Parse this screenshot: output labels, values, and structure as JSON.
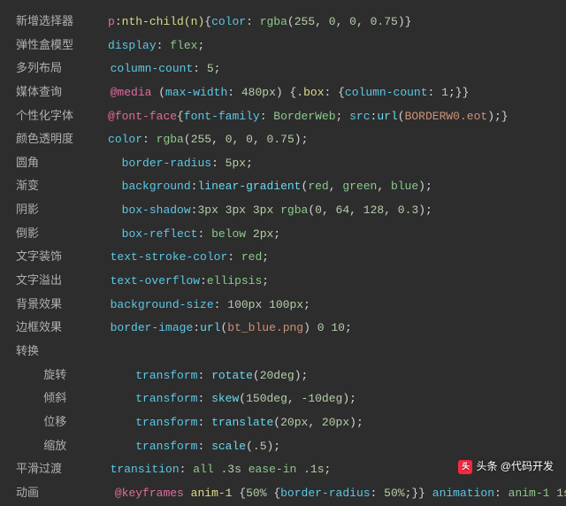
{
  "watermark": {
    "text": "头条 @代码开发"
  },
  "lines": [
    {
      "label": "新增选择器",
      "pad": "     ",
      "tokens": [
        {
          "t": "p",
          "c": "p-pink"
        },
        {
          "t": ":nth-child(n)",
          "c": "p-yellow"
        },
        {
          "t": "{",
          "c": "p-white"
        },
        {
          "t": "color",
          "c": "p-blue"
        },
        {
          "t": ": ",
          "c": "p-white"
        },
        {
          "t": "rgba",
          "c": "p-green"
        },
        {
          "t": "(",
          "c": "p-white"
        },
        {
          "t": "255",
          "c": "p-num"
        },
        {
          "t": ", ",
          "c": "p-white"
        },
        {
          "t": "0",
          "c": "p-num"
        },
        {
          "t": ", ",
          "c": "p-white"
        },
        {
          "t": "0",
          "c": "p-num"
        },
        {
          "t": ", ",
          "c": "p-white"
        },
        {
          "t": "0.75",
          "c": "p-num"
        },
        {
          "t": ")}",
          "c": "p-white"
        }
      ]
    },
    {
      "label": "弹性盒模型",
      "pad": "     ",
      "tokens": [
        {
          "t": "display",
          "c": "p-blue"
        },
        {
          "t": ": ",
          "c": "p-white"
        },
        {
          "t": "flex",
          "c": "p-green"
        },
        {
          "t": ";",
          "c": "p-white"
        }
      ]
    },
    {
      "label": "多列布局",
      "pad": "       ",
      "tokens": [
        {
          "t": "column-count",
          "c": "p-blue"
        },
        {
          "t": ": ",
          "c": "p-white"
        },
        {
          "t": "5",
          "c": "p-num"
        },
        {
          "t": ";",
          "c": "p-white"
        }
      ]
    },
    {
      "label": "媒体查询",
      "pad": "       ",
      "tokens": [
        {
          "t": "@media ",
          "c": "p-pink"
        },
        {
          "t": "(",
          "c": "p-white"
        },
        {
          "t": "max-width",
          "c": "p-blue"
        },
        {
          "t": ": ",
          "c": "p-white"
        },
        {
          "t": "480px",
          "c": "p-num"
        },
        {
          "t": ") {",
          "c": "p-white"
        },
        {
          "t": ".box",
          "c": "p-yellow"
        },
        {
          "t": ": {",
          "c": "p-white"
        },
        {
          "t": "column-count",
          "c": "p-blue"
        },
        {
          "t": ": ",
          "c": "p-white"
        },
        {
          "t": "1",
          "c": "p-num"
        },
        {
          "t": ";}}",
          "c": "p-white"
        }
      ]
    },
    {
      "label": "个性化字体",
      "pad": "     ",
      "tokens": [
        {
          "t": "@font-face",
          "c": "p-pink"
        },
        {
          "t": "{",
          "c": "p-white"
        },
        {
          "t": "font-family",
          "c": "p-blue"
        },
        {
          "t": ": ",
          "c": "p-white"
        },
        {
          "t": "BorderWeb",
          "c": "p-green"
        },
        {
          "t": "; ",
          "c": "p-white"
        },
        {
          "t": "src",
          "c": "p-blue"
        },
        {
          "t": ":",
          "c": "p-white"
        },
        {
          "t": "url",
          "c": "p-func"
        },
        {
          "t": "(",
          "c": "p-white"
        },
        {
          "t": "BORDERW0.eot",
          "c": "p-str"
        },
        {
          "t": ");}",
          "c": "p-white"
        }
      ]
    },
    {
      "label": "颜色透明度",
      "pad": "     ",
      "tokens": [
        {
          "t": "color",
          "c": "p-blue"
        },
        {
          "t": ": ",
          "c": "p-white"
        },
        {
          "t": "rgba",
          "c": "p-green"
        },
        {
          "t": "(",
          "c": "p-white"
        },
        {
          "t": "255",
          "c": "p-num"
        },
        {
          "t": ", ",
          "c": "p-white"
        },
        {
          "t": "0",
          "c": "p-num"
        },
        {
          "t": ", ",
          "c": "p-white"
        },
        {
          "t": "0",
          "c": "p-num"
        },
        {
          "t": ", ",
          "c": "p-white"
        },
        {
          "t": "0.75",
          "c": "p-num"
        },
        {
          "t": ");",
          "c": "p-white"
        }
      ]
    },
    {
      "label": "圆角",
      "pad": "            ",
      "tokens": [
        {
          "t": "border-radius",
          "c": "p-blue"
        },
        {
          "t": ": ",
          "c": "p-white"
        },
        {
          "t": "5px",
          "c": "p-num"
        },
        {
          "t": ";",
          "c": "p-white"
        }
      ]
    },
    {
      "label": "渐变",
      "pad": "            ",
      "tokens": [
        {
          "t": "background",
          "c": "p-blue"
        },
        {
          "t": ":",
          "c": "p-white"
        },
        {
          "t": "linear-gradient",
          "c": "p-func"
        },
        {
          "t": "(",
          "c": "p-white"
        },
        {
          "t": "red",
          "c": "p-green"
        },
        {
          "t": ", ",
          "c": "p-white"
        },
        {
          "t": "green",
          "c": "p-green"
        },
        {
          "t": ", ",
          "c": "p-white"
        },
        {
          "t": "blue",
          "c": "p-green"
        },
        {
          "t": ");",
          "c": "p-white"
        }
      ]
    },
    {
      "label": "阴影",
      "pad": "            ",
      "tokens": [
        {
          "t": "box-shadow",
          "c": "p-blue"
        },
        {
          "t": ":",
          "c": "p-white"
        },
        {
          "t": "3px 3px 3px ",
          "c": "p-num"
        },
        {
          "t": "rgba",
          "c": "p-green"
        },
        {
          "t": "(",
          "c": "p-white"
        },
        {
          "t": "0",
          "c": "p-num"
        },
        {
          "t": ", ",
          "c": "p-white"
        },
        {
          "t": "64",
          "c": "p-num"
        },
        {
          "t": ", ",
          "c": "p-white"
        },
        {
          "t": "128",
          "c": "p-num"
        },
        {
          "t": ", ",
          "c": "p-white"
        },
        {
          "t": "0.3",
          "c": "p-num"
        },
        {
          "t": ");",
          "c": "p-white"
        }
      ]
    },
    {
      "label": "倒影",
      "pad": "            ",
      "tokens": [
        {
          "t": "box-reflect",
          "c": "p-blue"
        },
        {
          "t": ": ",
          "c": "p-white"
        },
        {
          "t": "below ",
          "c": "p-green"
        },
        {
          "t": "2px",
          "c": "p-num"
        },
        {
          "t": ";",
          "c": "p-white"
        }
      ]
    },
    {
      "label": "文字装饰",
      "pad": "       ",
      "tokens": [
        {
          "t": "text-stroke-color",
          "c": "p-blue"
        },
        {
          "t": ": ",
          "c": "p-white"
        },
        {
          "t": "red",
          "c": "p-green"
        },
        {
          "t": ";",
          "c": "p-white"
        }
      ]
    },
    {
      "label": "文字溢出",
      "pad": "       ",
      "tokens": [
        {
          "t": "text-overflow",
          "c": "p-blue"
        },
        {
          "t": ":",
          "c": "p-white"
        },
        {
          "t": "ellipsis",
          "c": "p-green"
        },
        {
          "t": ";",
          "c": "p-white"
        }
      ]
    },
    {
      "label": "背景效果",
      "pad": "       ",
      "tokens": [
        {
          "t": "background-size",
          "c": "p-blue"
        },
        {
          "t": ": ",
          "c": "p-white"
        },
        {
          "t": "100px 100px",
          "c": "p-num"
        },
        {
          "t": ";",
          "c": "p-white"
        }
      ]
    },
    {
      "label": "边框效果",
      "pad": "       ",
      "tokens": [
        {
          "t": "border-image",
          "c": "p-blue"
        },
        {
          "t": ":",
          "c": "p-white"
        },
        {
          "t": "url",
          "c": "p-func"
        },
        {
          "t": "(",
          "c": "p-white"
        },
        {
          "t": "bt_blue.png",
          "c": "p-str"
        },
        {
          "t": ") ",
          "c": "p-white"
        },
        {
          "t": "0 10",
          "c": "p-num"
        },
        {
          "t": ";",
          "c": "p-white"
        }
      ]
    },
    {
      "label": "转换",
      "pad": "",
      "tokens": []
    },
    {
      "label": "    旋转",
      "pad": "          ",
      "tokens": [
        {
          "t": "transform",
          "c": "p-blue"
        },
        {
          "t": ": ",
          "c": "p-white"
        },
        {
          "t": "rotate",
          "c": "p-func"
        },
        {
          "t": "(",
          "c": "p-white"
        },
        {
          "t": "20deg",
          "c": "p-num"
        },
        {
          "t": ");",
          "c": "p-white"
        }
      ]
    },
    {
      "label": "    倾斜",
      "pad": "          ",
      "tokens": [
        {
          "t": "transform",
          "c": "p-blue"
        },
        {
          "t": ": ",
          "c": "p-white"
        },
        {
          "t": "skew",
          "c": "p-func"
        },
        {
          "t": "(",
          "c": "p-white"
        },
        {
          "t": "150deg",
          "c": "p-num"
        },
        {
          "t": ", ",
          "c": "p-white"
        },
        {
          "t": "-10deg",
          "c": "p-num"
        },
        {
          "t": ");",
          "c": "p-white"
        }
      ]
    },
    {
      "label": "    位移",
      "pad": "          ",
      "tokens": [
        {
          "t": "transform",
          "c": "p-blue"
        },
        {
          "t": ": ",
          "c": "p-white"
        },
        {
          "t": "translate",
          "c": "p-func"
        },
        {
          "t": "(",
          "c": "p-white"
        },
        {
          "t": "20px",
          "c": "p-num"
        },
        {
          "t": ", ",
          "c": "p-white"
        },
        {
          "t": "20px",
          "c": "p-num"
        },
        {
          "t": ");",
          "c": "p-white"
        }
      ]
    },
    {
      "label": "    缩放",
      "pad": "          ",
      "tokens": [
        {
          "t": "transform",
          "c": "p-blue"
        },
        {
          "t": ": ",
          "c": "p-white"
        },
        {
          "t": "scale",
          "c": "p-func"
        },
        {
          "t": "(",
          "c": "p-white"
        },
        {
          "t": ".5",
          "c": "p-num"
        },
        {
          "t": ");",
          "c": "p-white"
        }
      ]
    },
    {
      "label": "平滑过渡",
      "pad": "       ",
      "tokens": [
        {
          "t": "transition",
          "c": "p-blue"
        },
        {
          "t": ": ",
          "c": "p-white"
        },
        {
          "t": "all ",
          "c": "p-green"
        },
        {
          "t": ".3s ",
          "c": "p-num"
        },
        {
          "t": "ease-in ",
          "c": "p-green"
        },
        {
          "t": ".1s",
          "c": "p-num"
        },
        {
          "t": ";",
          "c": "p-white"
        }
      ]
    },
    {
      "label": "动画",
      "pad": "           ",
      "tokens": [
        {
          "t": "@keyframes ",
          "c": "p-pink"
        },
        {
          "t": "anim-1 ",
          "c": "p-yellow"
        },
        {
          "t": "{",
          "c": "p-white"
        },
        {
          "t": "50% ",
          "c": "p-num"
        },
        {
          "t": "{",
          "c": "p-white"
        },
        {
          "t": "border-radius",
          "c": "p-blue"
        },
        {
          "t": ": ",
          "c": "p-white"
        },
        {
          "t": "50%",
          "c": "p-num"
        },
        {
          "t": ";}} ",
          "c": "p-white"
        },
        {
          "t": "animation",
          "c": "p-blue"
        },
        {
          "t": ": ",
          "c": "p-white"
        },
        {
          "t": "anim-1 ",
          "c": "p-green"
        },
        {
          "t": "1s",
          "c": "p-num"
        }
      ]
    }
  ]
}
